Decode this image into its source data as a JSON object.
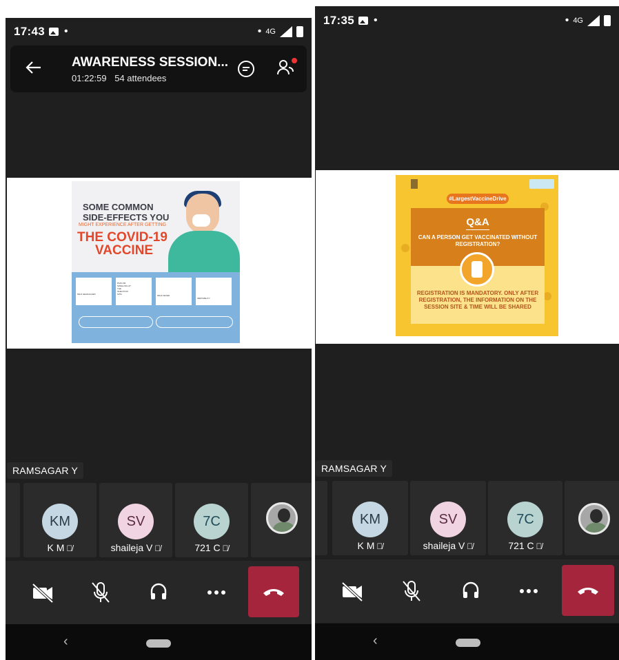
{
  "left": {
    "status": {
      "time": "17:43",
      "network": "4G"
    },
    "meeting": {
      "title": "AWARENESS SESSION...",
      "duration": "01:22:59",
      "attendees": "54 attendees"
    },
    "poster": {
      "line1": "SOME COMMON",
      "line2": "SIDE-EFFECTS YOU",
      "line3": "MIGHT EXPERIENCE AFTER GETTING",
      "line4": "THE COVID-19",
      "line5": "VACCINE",
      "card1": "MILD HEADACHES",
      "card2": "PAIN OR SWELLING AT THE INJECTION SITE",
      "card3": "MILD FEVER",
      "card4": "IRRITABILITY"
    },
    "speaker": "RAMSAGAR Y",
    "participants": [
      {
        "initials": "KM",
        "name": "K M"
      },
      {
        "initials": "SV",
        "name": "shaileja V"
      },
      {
        "initials": "7C",
        "name": "721 C"
      }
    ]
  },
  "right": {
    "status": {
      "time": "17:35",
      "network": "4G"
    },
    "poster": {
      "tag": "#LargestVaccineDrive",
      "qa": "Q&A",
      "question": "CAN A PERSON GET VACCINATED WITHOUT REGISTRATION?",
      "answer": "REGISTRATION IS MANDATORY. ONLY AFTER REGISTRATION, THE INFORMATION ON THE SESSION SITE & TIME WILL BE SHARED"
    },
    "speaker": "RAMSAGAR Y",
    "participants": [
      {
        "initials": "KM",
        "name": "K M"
      },
      {
        "initials": "SV",
        "name": "shaileja V"
      },
      {
        "initials": "7C",
        "name": "721 C"
      }
    ]
  },
  "icons": {
    "camera": "video-off-icon",
    "mic": "mic-off-icon",
    "audio": "headphones-icon",
    "more": "more-icon",
    "hangup": "hang-up-icon"
  },
  "colors": {
    "hangup": "#a4253c",
    "notif": "#e33333"
  }
}
